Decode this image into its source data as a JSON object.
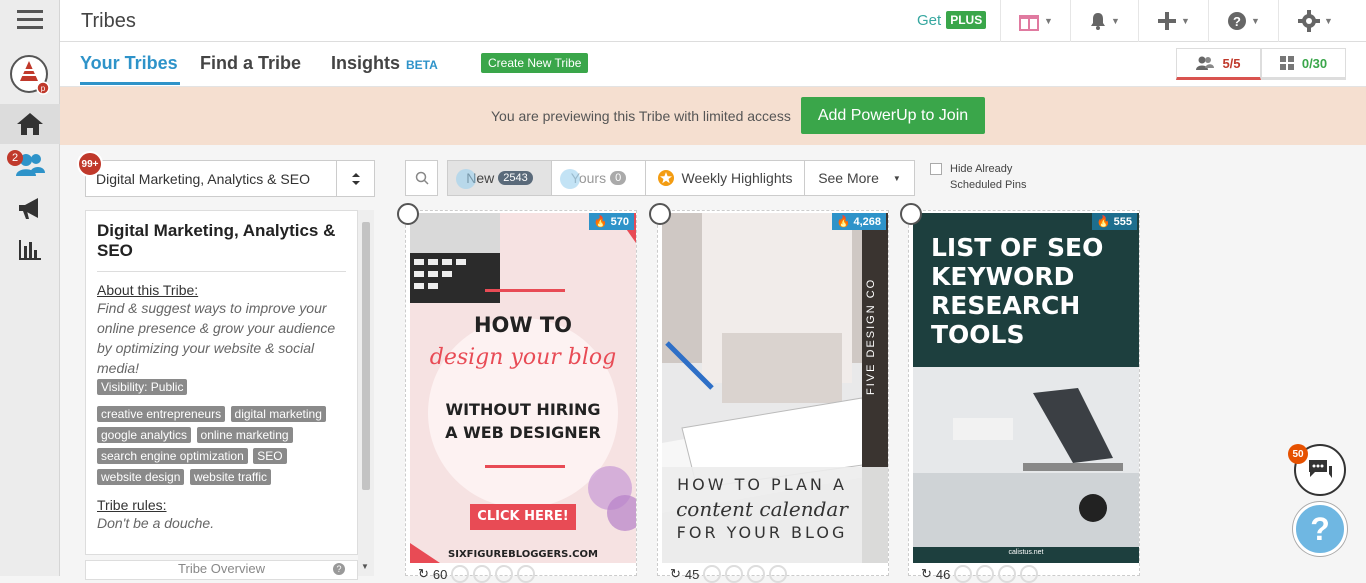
{
  "app": {
    "title": "Tribes"
  },
  "topbar": {
    "get_label": "Get",
    "plus_label": "PLUS"
  },
  "tabs": [
    {
      "label": "Your Tribes"
    },
    {
      "label": "Find a Tribe"
    },
    {
      "label": "Insights"
    }
  ],
  "tabs_beta": "BETA",
  "create_button": "Create New Tribe",
  "quota": {
    "members": "5/5",
    "pins": "0/30"
  },
  "rail": {
    "notification_count": "2"
  },
  "preview": {
    "text": "You are previewing this Tribe with limited access",
    "button": "Add PowerUp to Join"
  },
  "tribe_select": {
    "value": "Digital Marketing, Analytics & SEO",
    "badge": "99+"
  },
  "tribe_info": {
    "title": "Digital Marketing, Analytics & SEO",
    "about_label": "About this Tribe:",
    "description": "Find & suggest ways to improve your online presence & grow your audience by optimizing your website & social media!",
    "visibility": "Visibility: Public",
    "tags": [
      "creative entrepreneurs",
      "digital marketing",
      "google analytics",
      "online marketing",
      "search engine optimization",
      "SEO",
      "website design",
      "website traffic"
    ],
    "rules_label": "Tribe rules:",
    "rules": "Don't be a douche.",
    "overview_tab": "Tribe Overview"
  },
  "filters": {
    "new_label": "New",
    "new_count": "2543",
    "yours_label": "Yours",
    "yours_count": "0",
    "weekly": "Weekly Highlights",
    "see_more": "See More",
    "hide_label_1": "Hide Already",
    "hide_label_2": "Scheduled Pins"
  },
  "pins": [
    {
      "heat": "570",
      "repins": "60",
      "lines": [
        "HOW TO",
        "design your blog",
        "WITHOUT HIRING",
        "A WEB DESIGNER",
        "CLICK HERE!",
        "SIXFIGUREBLOGGERS.COM"
      ]
    },
    {
      "heat": "4,268",
      "repins": "45",
      "lines": [
        "FIVE DESIGN CO",
        "HOW TO PLAN A",
        "content calendar",
        "FOR YOUR BLOG"
      ]
    },
    {
      "heat": "555",
      "repins": "46",
      "lines": [
        "LIST OF SEO",
        "KEYWORD",
        "RESEARCH",
        "TOOLS",
        "calistus.net"
      ]
    }
  ],
  "chat": {
    "badge": "50"
  },
  "help": {
    "label": "?"
  },
  "colors": {
    "accent": "#2e93c9",
    "green": "#3aa64a",
    "preview_bg": "#f5dfd0",
    "red": "#c0392b"
  }
}
